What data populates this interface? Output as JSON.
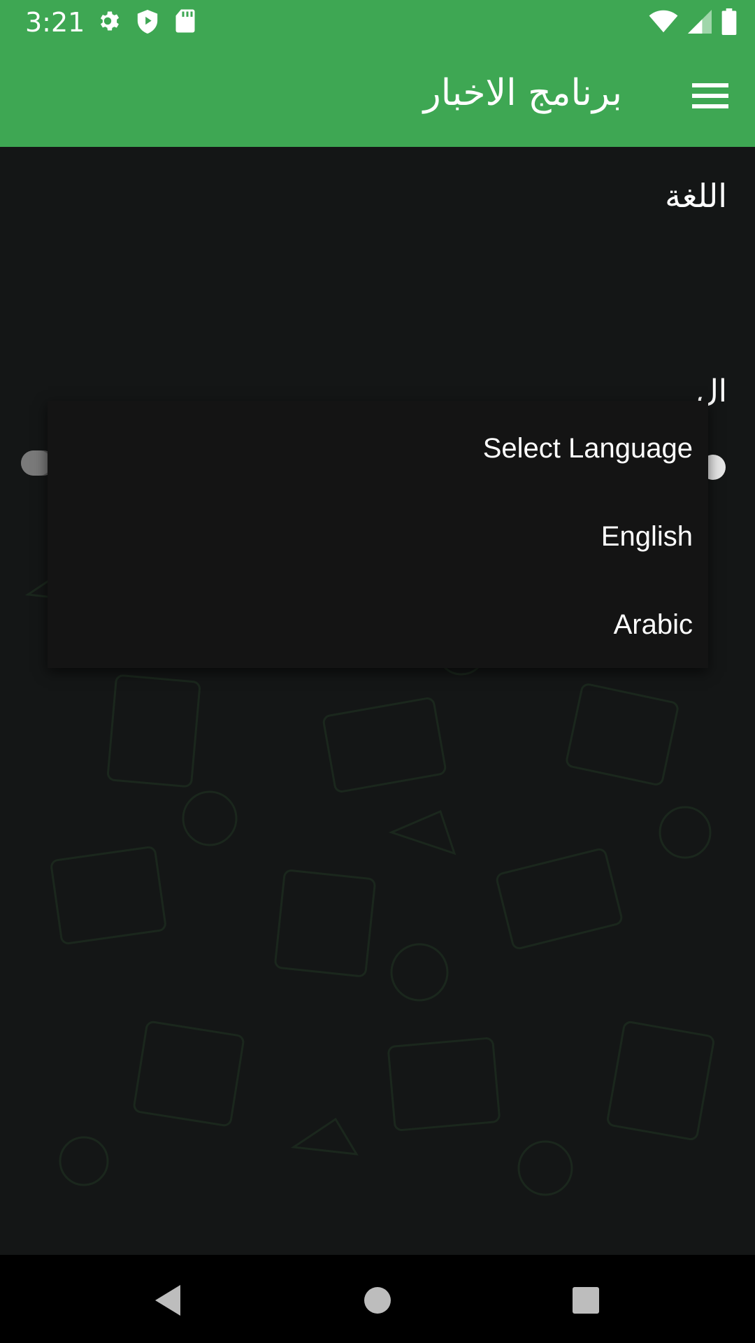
{
  "status_bar": {
    "time": "3:21",
    "left_icons": [
      "gear-icon",
      "shield-play-icon",
      "sd-card-icon"
    ],
    "right_icons": [
      "wifi-icon",
      "cell-signal-icon",
      "battery-icon"
    ]
  },
  "app_bar": {
    "title": "برنامج الاخبار",
    "menu_icon": "hamburger-menu-icon",
    "background_color": "#3ea753"
  },
  "settings": {
    "language_heading": "اللغة",
    "partial_row_text": "ال"
  },
  "language_menu": {
    "items": [
      "Select Language",
      "English",
      "Arabic"
    ]
  },
  "nav_bar": {
    "back_icon": "back-triangle-icon",
    "home_icon": "home-circle-icon",
    "recents_icon": "recents-square-icon"
  }
}
